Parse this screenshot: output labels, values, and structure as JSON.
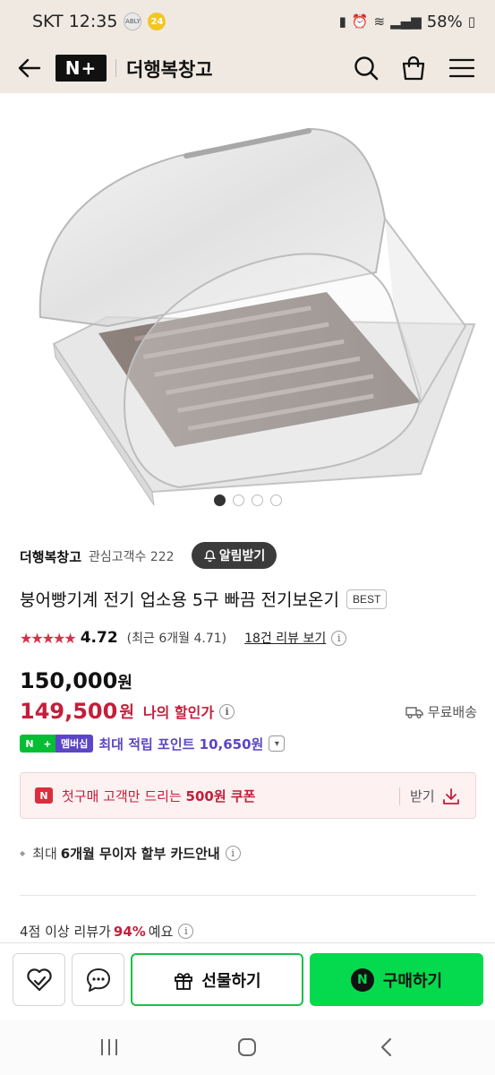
{
  "status_bar": {
    "carrier_time": "SKT 12:35",
    "badge1": "ABLY",
    "badge2": "24",
    "battery": "58%"
  },
  "header": {
    "logo_text": "N+",
    "store_title": "더행복창고",
    "icons": [
      "back-arrow-icon",
      "search-icon",
      "shopping-bag-icon",
      "menu-icon"
    ]
  },
  "gallery": {
    "image_alt": "Clear roll-top bread display case with stainless tray",
    "total_images": 4,
    "active_index": 1
  },
  "store": {
    "name": "더행복창고",
    "followers": "관심고객수 222",
    "alarm_label": "알림받기"
  },
  "product": {
    "title": "붕어빵기계 전기 업소용 5구 빠끔 전기보온기",
    "badge": "BEST",
    "stars": "★★★★★",
    "rating": "4.72",
    "recent_rating": "(최근 6개월 4.71)",
    "review_link": "18건 리뷰 보기"
  },
  "price": {
    "original": "150,000",
    "original_unit": "원",
    "sale": "149,500",
    "sale_unit": "원",
    "my_discount": "나의 할인가",
    "shipping": "무료배송"
  },
  "membership": {
    "n": "N",
    "plus": "+",
    "badge": "멤버십",
    "points": "최대 적립 포인트 10,650원"
  },
  "coupon": {
    "icon_letter": "N",
    "text_prefix": "첫구매 고객만 드리는 ",
    "text_bold": "500원 쿠폰",
    "get_label": "받기"
  },
  "installment": {
    "prefix": "최대",
    "bold": "6개월 무이자 할부 카드안내"
  },
  "review_summary": {
    "prefix": "4점 이상 리뷰가",
    "percent": "94%",
    "suffix": "예요"
  },
  "actions": {
    "gift_label": "선물하기",
    "buy_label": "구매하기",
    "buy_icon_letter": "N"
  },
  "colors": {
    "header_bg": "#efe9e1",
    "sale_red": "#c41e3a",
    "naver_green": "#05d94d",
    "membership_purple": "#5c45c6"
  }
}
